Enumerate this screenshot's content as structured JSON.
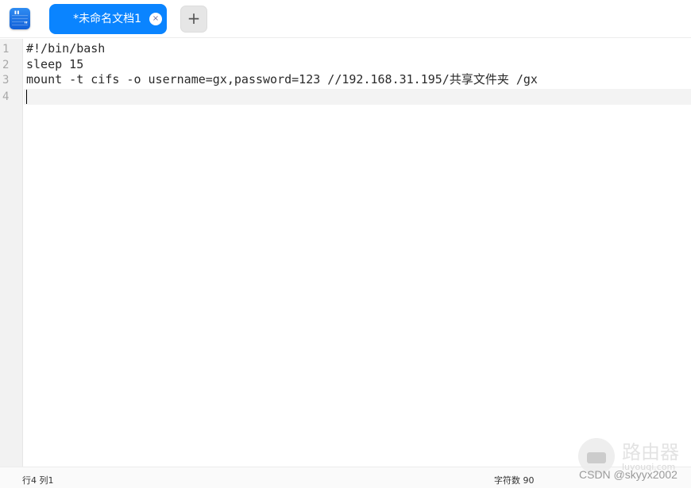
{
  "titlebar": {
    "app_icon": "text-editor-quote-icon",
    "tabs": [
      {
        "label": "*未命名文档1",
        "active": true,
        "close_glyph": "×"
      }
    ],
    "add_tab_glyph": "+"
  },
  "editor": {
    "lines": [
      {
        "number": "1",
        "text": "#!/bin/bash"
      },
      {
        "number": "2",
        "text": "sleep 15"
      },
      {
        "number": "3",
        "text": "mount -t cifs -o username=gx,password=123 //192.168.31.195/共享文件夹 /gx"
      },
      {
        "number": "4",
        "text": ""
      }
    ],
    "current_line": 4
  },
  "statusbar": {
    "position": "行4 列1",
    "char_count": "字符数 90"
  },
  "watermark": {
    "title": "路由器",
    "subtitle": "luyouqi.com",
    "credit": "CSDN @skyyx2002"
  },
  "colors": {
    "accent": "#0a84ff",
    "gutter_bg": "#f2f2f2",
    "current_line_bg": "#f3f3f3"
  }
}
